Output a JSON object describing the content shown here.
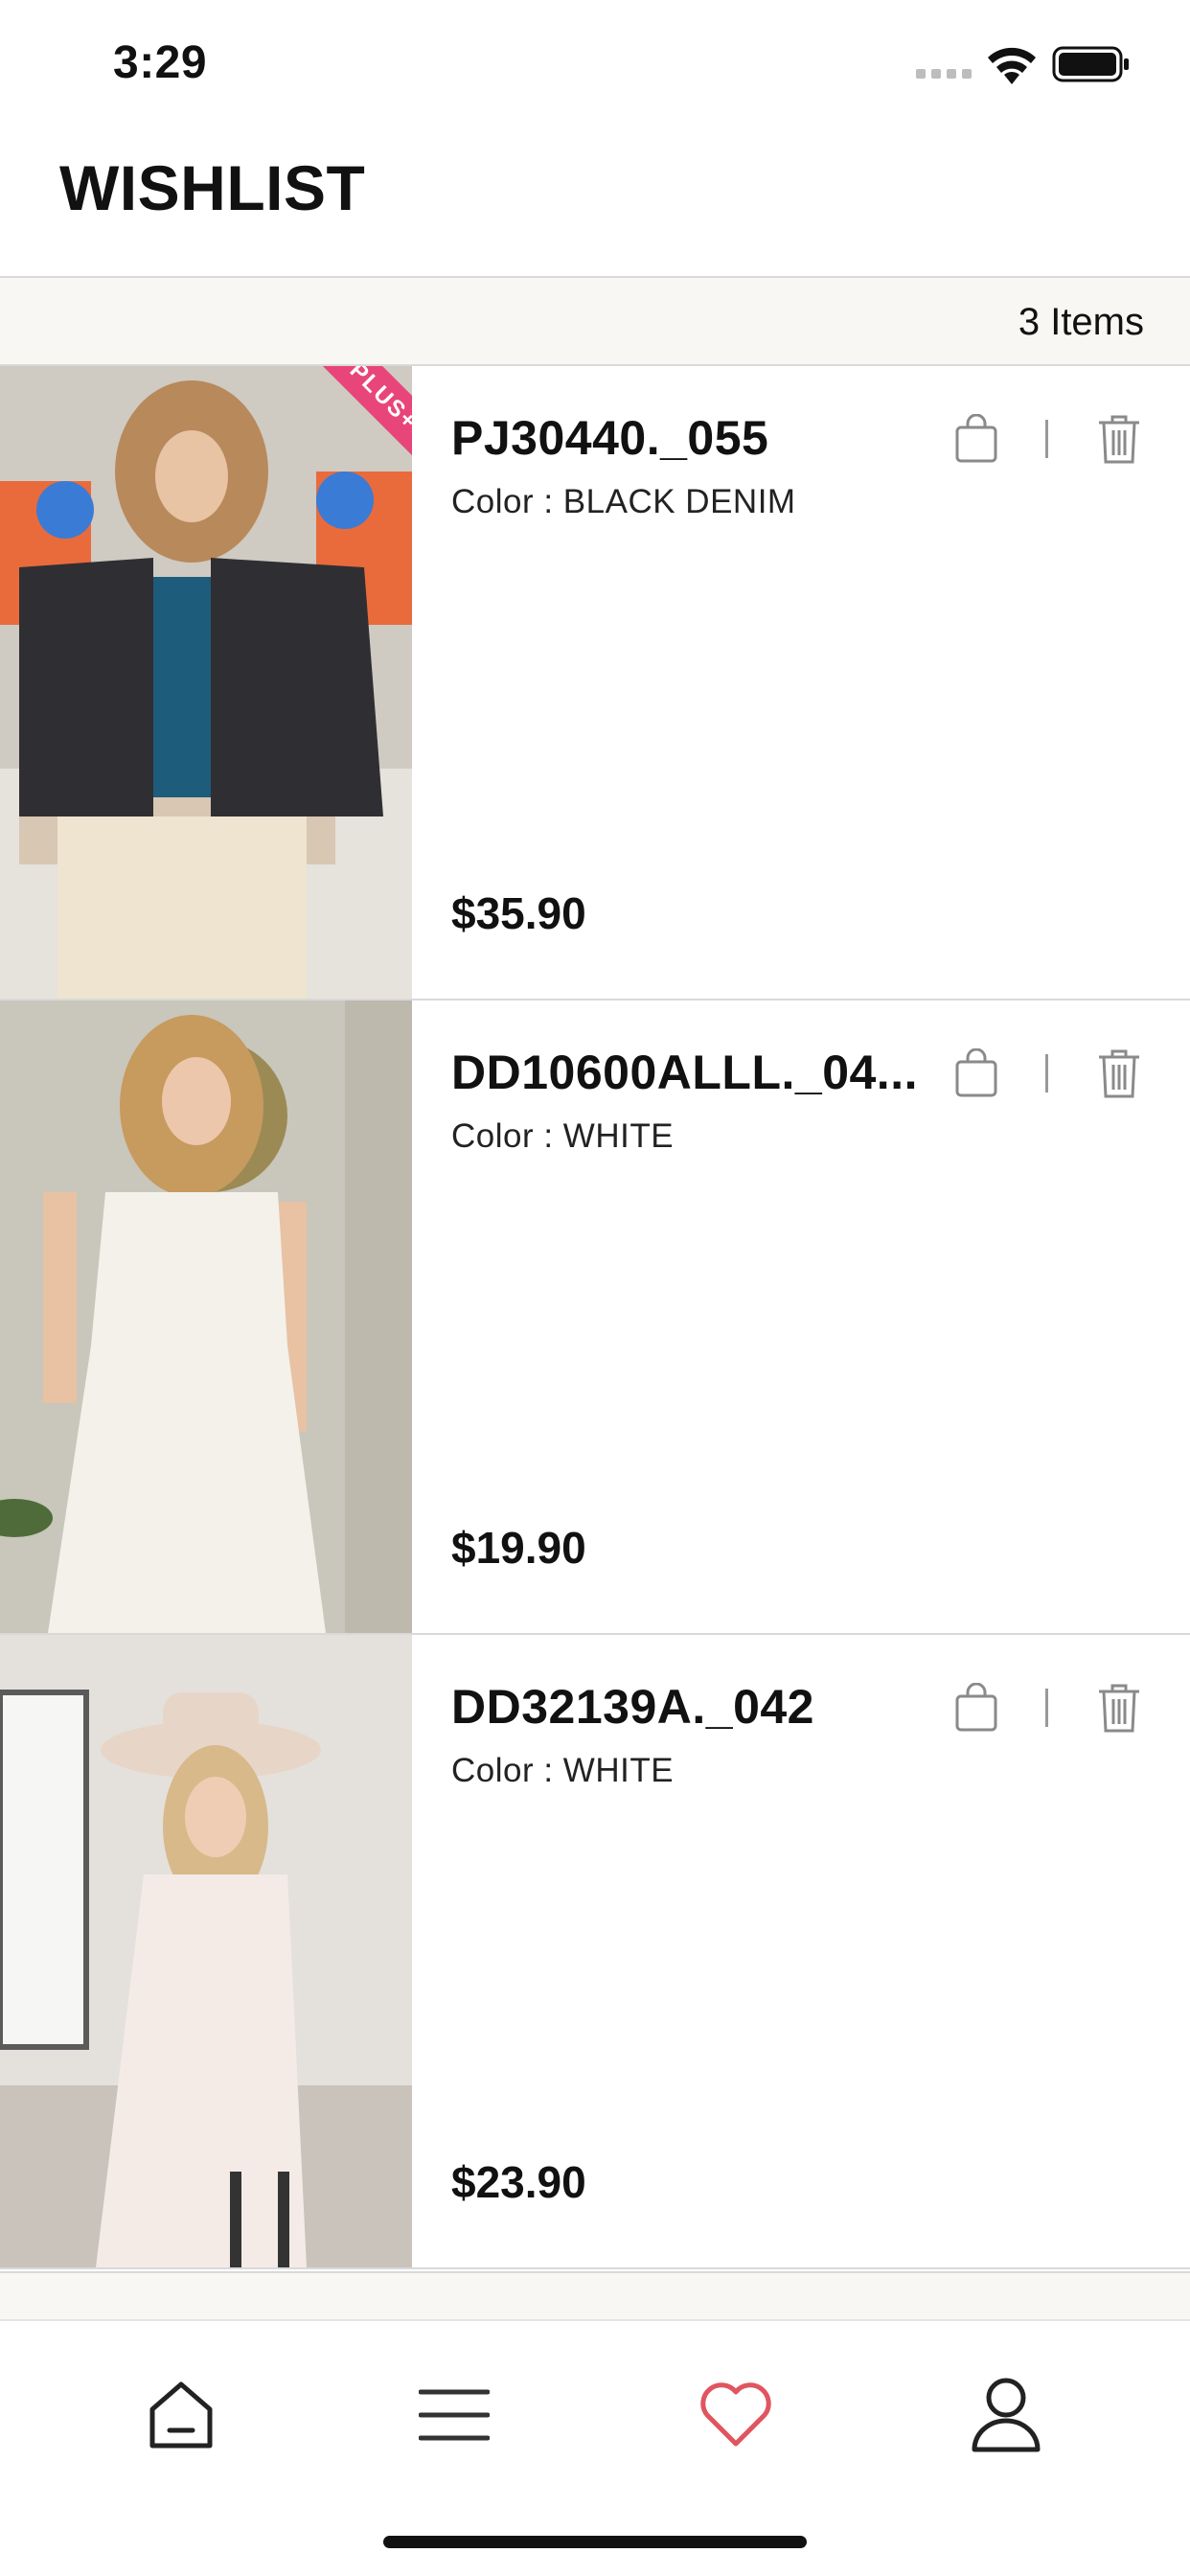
{
  "status": {
    "time": "3:29"
  },
  "header": {
    "title": "WISHLIST"
  },
  "summary": {
    "count_label": "3 Items"
  },
  "items": [
    {
      "name": "PJ30440._055",
      "color": "Color : BLACK DENIM",
      "price": "$35.90",
      "badge": "PLUS+"
    },
    {
      "name": "DD10600ALLL._04...",
      "color": "Color : WHITE",
      "price": "$19.90"
    },
    {
      "name": "DD32139A._042",
      "color": "Color : WHITE",
      "price": "$23.90"
    }
  ],
  "tabs": [
    {
      "name": "home",
      "icon": "home-icon",
      "active": false
    },
    {
      "name": "menu",
      "icon": "menu-icon",
      "active": false
    },
    {
      "name": "wishlist",
      "icon": "heart-icon",
      "active": true
    },
    {
      "name": "account",
      "icon": "user-icon",
      "active": false
    }
  ],
  "colors": {
    "accent": "#e0555f",
    "divider": "#d9d9d9",
    "band": "#f8f7f4"
  }
}
